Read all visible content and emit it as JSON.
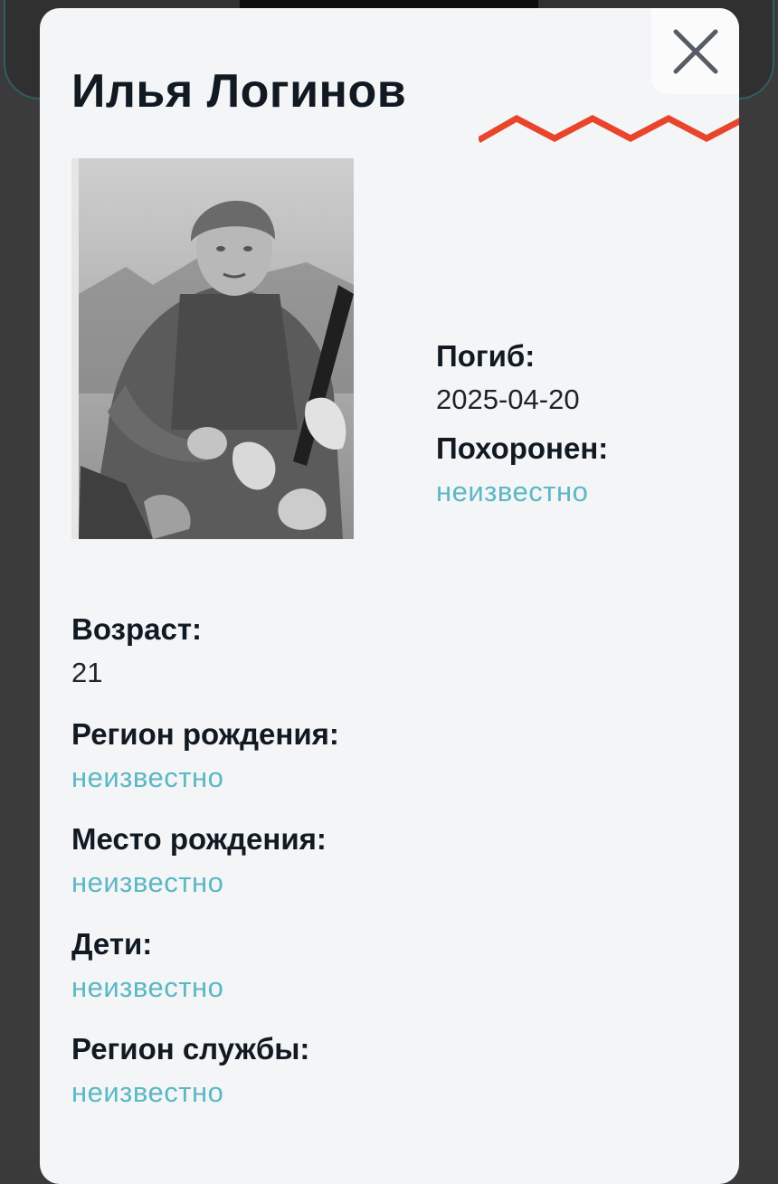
{
  "person": {
    "name": "Илья Логинов",
    "photo_alt": "portrait-photo"
  },
  "close": {
    "icon": "close-icon"
  },
  "accent_colors": {
    "zigzag": "#e8452c",
    "unknown_value": "#5bb8c4",
    "text": "#111a22",
    "modal_bg": "#f4f5f7"
  },
  "right_fields": [
    {
      "label": "Погиб:",
      "value": "2025-04-20",
      "unknown": false
    },
    {
      "label": "Похоронен:",
      "value": "неизвестно",
      "unknown": true
    }
  ],
  "left_fields": [
    {
      "label": "Возраст:",
      "value": "21",
      "unknown": false
    },
    {
      "label": "Регион рождения:",
      "value": "неизвестно",
      "unknown": true
    },
    {
      "label": "Место рождения:",
      "value": "неизвестно",
      "unknown": true
    },
    {
      "label": "Дети:",
      "value": "неизвестно",
      "unknown": true
    },
    {
      "label": "Регион службы:",
      "value": "неизвестно",
      "unknown": true
    }
  ]
}
